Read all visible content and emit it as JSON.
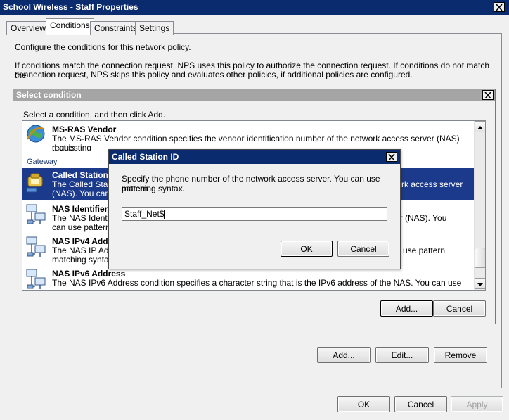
{
  "window": {
    "title": "School Wireless - Staff Properties"
  },
  "tabs": [
    {
      "label": "Overview"
    },
    {
      "label": "Conditions"
    },
    {
      "label": "Constraints"
    },
    {
      "label": "Settings"
    }
  ],
  "conditions_page": {
    "intro": "Configure the conditions for this network policy.",
    "description_line1": "If conditions match the connection request, NPS uses this policy to authorize the connection request. If conditions do not match the",
    "description_line2": "connection request, NPS skips this policy and evaluates other policies, if additional policies are configured.",
    "add_label": "Add...",
    "edit_label": "Edit...",
    "remove_label": "Remove"
  },
  "select_condition": {
    "title": "Select condition",
    "instruction": "Select a condition, and then click Add.",
    "group_label": "Gateway",
    "items": [
      {
        "title": "MS-RAS Vendor",
        "desc_line1": "The MS-RAS Vendor condition specifies the vendor identification number of the network access server (NAS) that is",
        "desc_line2": "requesting authentication."
      },
      {
        "title": "Called Station",
        "desc_line1": "The Called Statio",
        "desc_line1_right": "rk access server",
        "desc_line2": "(NAS). You can"
      },
      {
        "title": "NAS Identifier",
        "desc_line1": "The NAS Identifi",
        "desc_line1_right": "er (NAS). You",
        "desc_line2": "can use pattern"
      },
      {
        "title": "NAS IPv4 Addr",
        "desc_line1": "The NAS IP Add",
        "desc_line1_right": "use pattern",
        "desc_line2": "matching syntax"
      },
      {
        "title": "NAS IPv6 Address",
        "desc_line1": "The NAS IPv6 Address condition specifies a character string that is the IPv6 address of the NAS. You can use",
        "desc_line2": ""
      }
    ],
    "add_label": "Add...",
    "cancel_label": "Cancel"
  },
  "called_station_dialog": {
    "title": "Called Station ID",
    "prompt_line1": "Specify the phone number of the network access server. You can use pattern",
    "prompt_line2": "matching syntax.",
    "input_value": "Staff_Net$",
    "ok_label": "OK",
    "cancel_label": "Cancel"
  },
  "footer": {
    "ok_label": "OK",
    "cancel_label": "Cancel",
    "apply_label": "Apply"
  },
  "icons": {
    "ms_ras_vendor": "globe-connection-icon",
    "called_station": "phone-network-icon",
    "nas_identifier": "network-computers-icon",
    "nas_ipv4": "network-computers-icon",
    "nas_ipv6": "network-computers-icon"
  },
  "colors": {
    "title_bar": "#0b2b6f",
    "selection": "#1c3a8c",
    "inactive_title": "#a5a5a5"
  }
}
